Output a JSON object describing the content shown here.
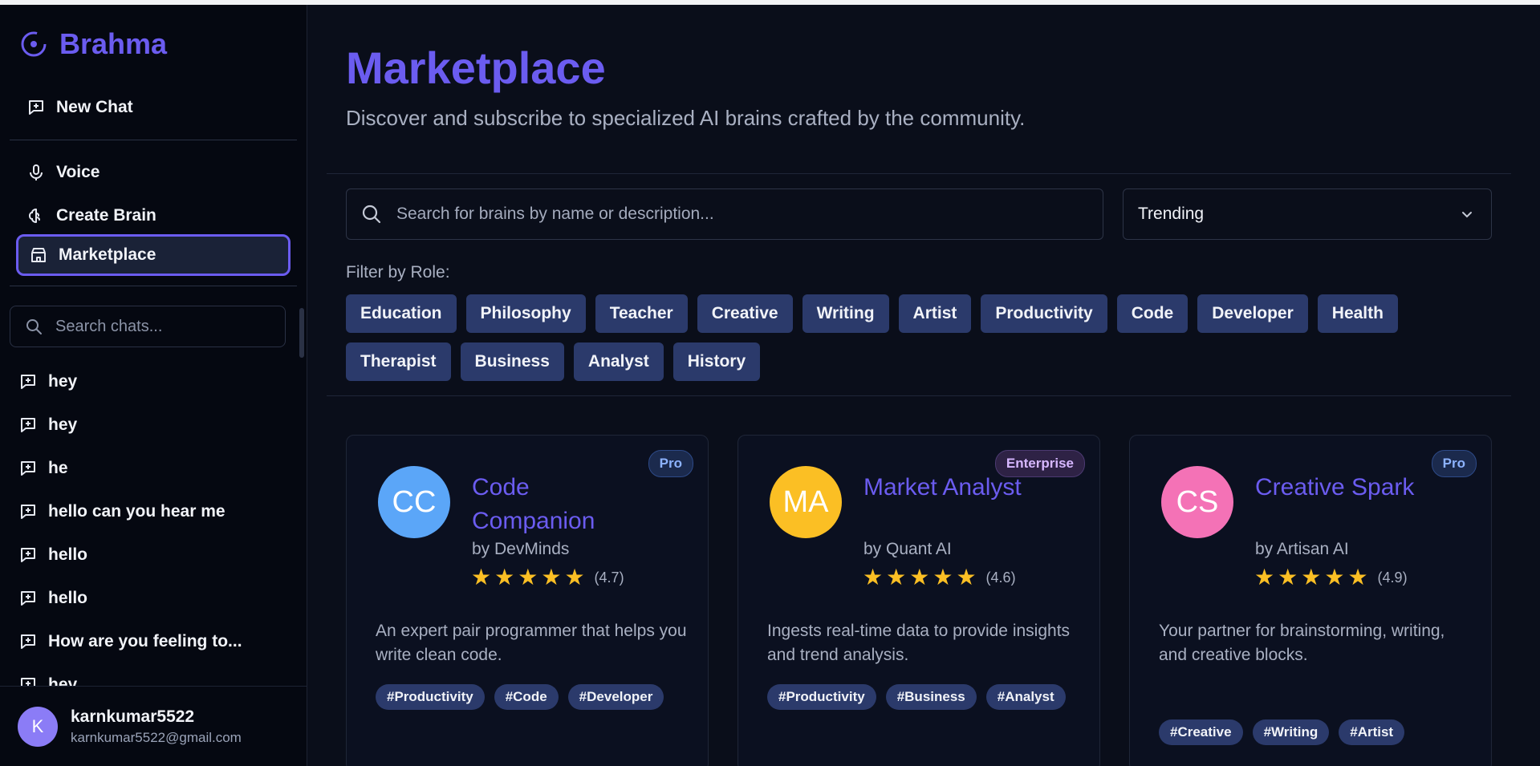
{
  "brand": {
    "name": "Brahma"
  },
  "nav": {
    "new_chat": "New Chat",
    "voice": "Voice",
    "create_brain": "Create Brain",
    "marketplace": "Marketplace"
  },
  "chat_search": {
    "placeholder": "Search chats..."
  },
  "chats": [
    "hey",
    "hey",
    "he",
    "hello can you hear me",
    "hello",
    "hello",
    "How are you feeling to...",
    "hey"
  ],
  "user": {
    "initial": "K",
    "name": "karnkumar5522",
    "email": "karnkumar5522@gmail.com"
  },
  "page": {
    "title": "Marketplace",
    "subtitle": "Discover and subscribe to specialized AI brains crafted by the community."
  },
  "search": {
    "placeholder": "Search for brains by name or description..."
  },
  "sort": {
    "selected": "Trending"
  },
  "filter": {
    "label": "Filter by Role:",
    "roles": [
      "Education",
      "Philosophy",
      "Teacher",
      "Creative",
      "Writing",
      "Artist",
      "Productivity",
      "Code",
      "Developer",
      "Health",
      "Therapist",
      "Business",
      "Analyst",
      "History"
    ]
  },
  "cards": [
    {
      "initials": "CC",
      "avatar_color": "#5ba6f8",
      "badge": "Pro",
      "badge_kind": "pro",
      "name": "Code Companion",
      "author": "by DevMinds",
      "rating_value": 4.7,
      "rating": "(4.7)",
      "description": "An expert pair programmer that helps you write clean code.",
      "tags": [
        "#Productivity",
        "#Code",
        "#Developer"
      ]
    },
    {
      "initials": "MA",
      "avatar_color": "#fbbf24",
      "badge": "Enterprise",
      "badge_kind": "ent",
      "name": "Market Analyst",
      "author": "by Quant AI",
      "rating_value": 4.6,
      "rating": "(4.6)",
      "description": "Ingests real-time data to provide insights and trend analysis.",
      "tags": [
        "#Productivity",
        "#Business",
        "#Analyst"
      ]
    },
    {
      "initials": "CS",
      "avatar_color": "#f472b6",
      "badge": "Pro",
      "badge_kind": "pro",
      "name": "Creative Spark",
      "author": "by Artisan AI",
      "rating_value": 4.9,
      "rating": "(4.9)",
      "description": "Your partner for brainstorming, writing, and creative blocks.",
      "tags": [
        "#Creative",
        "#Writing",
        "#Artist"
      ]
    }
  ]
}
